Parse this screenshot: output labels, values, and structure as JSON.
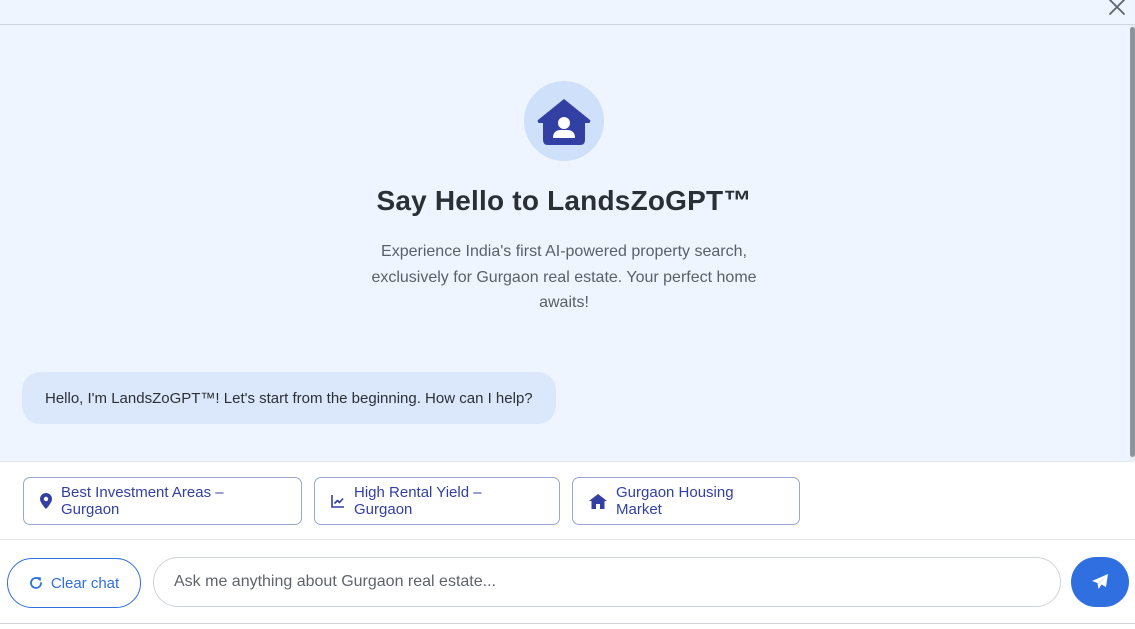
{
  "header": {
    "close_icon": "close-icon"
  },
  "hero": {
    "icon": "house-user-icon",
    "title": "Say Hello to LandsZoGPT™",
    "subtitle": "Experience India's first AI-powered property search, exclusively for Gurgaon real estate. Your perfect home awaits!"
  },
  "messages": [
    {
      "role": "bot",
      "text": "Hello, I'm LandsZoGPT™! Let's start from the beginning. How can I help?"
    }
  ],
  "suggestions": [
    {
      "label": "Best Investment Areas – Gurgaon",
      "icon": "map-pin-icon"
    },
    {
      "label": "High Rental Yield – Gurgaon",
      "icon": "line-chart-icon"
    },
    {
      "label": "Gurgaon Housing Market",
      "icon": "home-icon"
    }
  ],
  "composer": {
    "clear_label": "Clear chat",
    "placeholder": "Ask me anything about Gurgaon real estate...",
    "value": "",
    "send_icon": "send-icon"
  },
  "colors": {
    "accent": "#2f6fe0",
    "chip_text": "#3340a3",
    "background": "#eef5fe",
    "bubble": "#dbe8fb"
  }
}
